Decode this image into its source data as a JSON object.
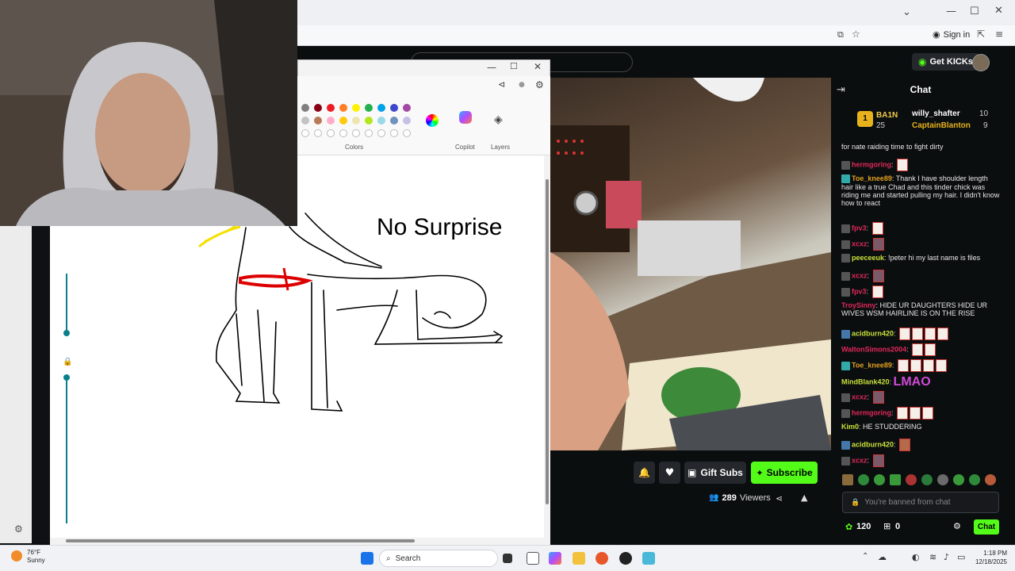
{
  "browser": {
    "sign_in": "Sign in"
  },
  "kick": {
    "get_kicks": "Get KICKs",
    "gift_subs": "Gift Subs",
    "subscribe": "Subscribe",
    "viewers_count": "289",
    "viewers_label": "Viewers",
    "accent": "#53fc18"
  },
  "paint": {
    "colors_label": "Colors",
    "copilot_label": "Copilot",
    "layers_label": "Layers",
    "drawing_text": "No Surprise",
    "palette": [
      "#7f7f7f",
      "#880015",
      "#ed1c24",
      "#ff7f27",
      "#fff200",
      "#22b14c",
      "#00a2e8",
      "#3f48cc",
      "#a349a4",
      "#c3c3c3",
      "#b97a57",
      "#ffaec9",
      "#ffc90e",
      "#efe4b0",
      "#b5e61d",
      "#99d9ea",
      "#7092be",
      "#c8bfe7"
    ]
  },
  "chat": {
    "title": "Chat",
    "gifters": [
      {
        "rank": "1",
        "name": "BA1N",
        "count": "25"
      },
      {
        "name": "willy_shafter",
        "count": "10"
      },
      {
        "name": "CaptainBlanton",
        "count": "9"
      }
    ],
    "messages": [
      {
        "user": "",
        "text": "for nate raiding time to fight dirty",
        "color": "#e6e6e6"
      },
      {
        "user": "hermgoring",
        "text": "",
        "color": "#e0285a"
      },
      {
        "user": "Toe_knee89",
        "text": "Thank I have shoulder length hair like a true Chad and this tinder chick was riding me and started pulling my hair. I didn't know how to react",
        "color": "#e0a020"
      },
      {
        "user": "fpv3",
        "text": "",
        "color": "#e0285a"
      },
      {
        "user": "xcxz",
        "text": "",
        "color": "#e0285a"
      },
      {
        "user": "peeceeuk",
        "text": "!peter hi my last name is files",
        "color": "#c8e03a"
      },
      {
        "user": "xcxz",
        "text": "",
        "color": "#e0285a"
      },
      {
        "user": "fpv3",
        "text": "",
        "color": "#e0285a"
      },
      {
        "user": "TroySinny",
        "text": "HIDE UR DAUGHTERS HIDE UR WIVES WSM HAIRLINE IS ON THE RISE",
        "color": "#e0285a"
      },
      {
        "user": "acidburn420",
        "text": "",
        "color": "#c8e03a"
      },
      {
        "user": "WaltonSimons2004",
        "text": "",
        "color": "#e0285a"
      },
      {
        "user": "Toe_knee89",
        "text": "",
        "color": "#e0a020"
      },
      {
        "user": "MindBlank420",
        "text": "LMAO",
        "color": "#c8e03a"
      },
      {
        "user": "xcxz",
        "text": "",
        "color": "#e0285a"
      },
      {
        "user": "hermgoring",
        "text": "",
        "color": "#e0285a"
      },
      {
        "user": "Kim0",
        "text": "HE STUDDERING",
        "color": "#c8e03a"
      },
      {
        "user": "acidburn420",
        "text": "",
        "color": "#c8e03a"
      },
      {
        "user": "xcxz",
        "text": "",
        "color": "#e0285a"
      }
    ],
    "banned": "You're banned from chat",
    "points": "120",
    "gift_count": "0",
    "send": "Chat"
  },
  "taskbar": {
    "temp": "76°F",
    "condition": "Sunny",
    "search": "Search",
    "time": "1:18 PM",
    "date": "12/18/2025"
  }
}
